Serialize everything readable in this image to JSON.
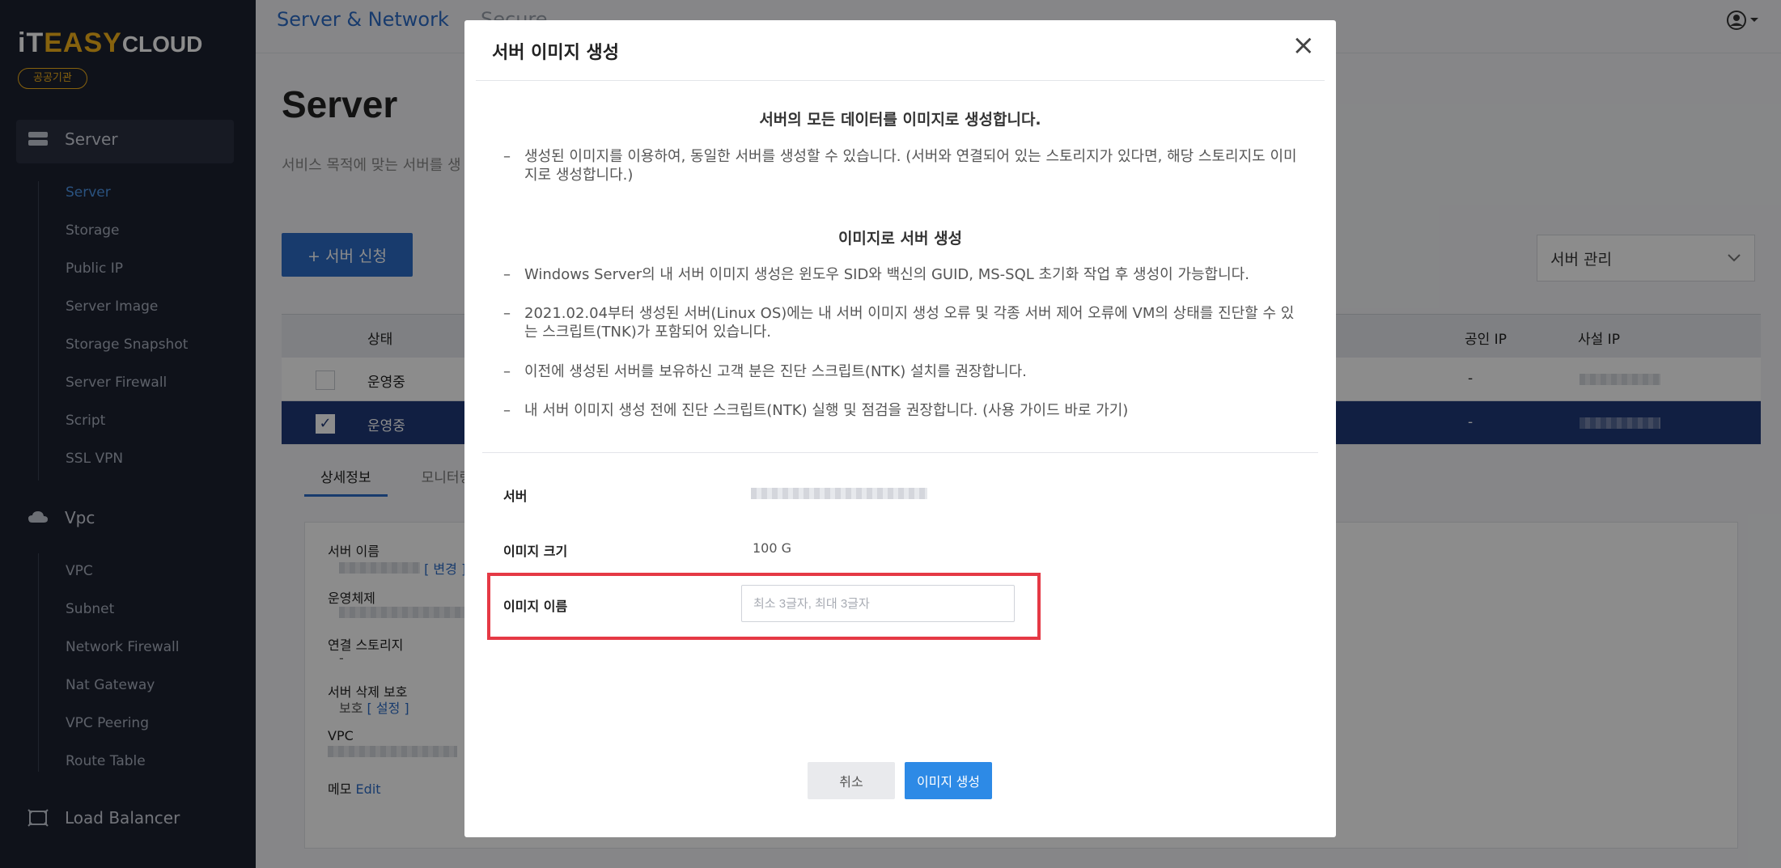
{
  "brand": {
    "logo_i": "iT",
    "logo_easy": "EASY",
    "logo_cloud": "CLOUD",
    "badge": "공공기관"
  },
  "sidebar": {
    "groups": [
      {
        "label": "Server",
        "icon": "server-icon"
      },
      {
        "label": "Vpc",
        "icon": "cloud-icon"
      },
      {
        "label": "Load Balancer",
        "icon": "load-balancer-icon"
      }
    ],
    "server_items": [
      "Server",
      "Storage",
      "Public IP",
      "Server Image",
      "Storage Snapshot",
      "Server Firewall",
      "Script",
      "SSL VPN"
    ],
    "vpc_items": [
      "VPC",
      "Subnet",
      "Network Firewall",
      "Nat Gateway",
      "VPC Peering",
      "Route Table"
    ]
  },
  "topbar": {
    "crumb_main": "Server & Network",
    "crumb_secure": "Secure"
  },
  "page": {
    "title": "Server",
    "description": "서비스 목적에 맞는 서버를 생",
    "new_button": "+ 서버 신청",
    "manage_select": "서버 관리",
    "table_headers": {
      "status": "상태",
      "public_ip": "공인 IP",
      "private_ip": "사설 IP"
    },
    "rows": [
      {
        "status": "운영중",
        "public_ip": "-"
      },
      {
        "status": "운영중",
        "public_ip": "-"
      }
    ],
    "tabs": [
      "상세정보",
      "모니터링"
    ],
    "detail": {
      "server_name_label": "서버 이름",
      "change_link": "[ 변경 ]",
      "os_label": "운영체제",
      "storage_label": "연결 스토리지",
      "storage_value": "-",
      "protect_label": "서버 삭제 보호",
      "protect_value": "보호",
      "protect_link": "[ 설정 ]",
      "vpc_label": "VPC",
      "memo_label": "메모",
      "memo_link": "Edit"
    }
  },
  "modal": {
    "title": "서버 이미지 생성",
    "section1_title": "서버의 모든 데이터를 이미지로 생성합니다.",
    "section1_bullets": [
      "생성된 이미지를 이용하여, 동일한 서버를 생성할 수 있습니다. (서버와 연결되어 있는 스토리지가 있다면, 해당 스토리지도 이미지로 생성합니다.)"
    ],
    "section2_title": "이미지로 서버 생성",
    "section2_bullets": [
      "Windows Server의 내 서버 이미지 생성은 윈도우 SID와 백신의 GUID, MS-SQL 초기화 작업 후 생성이 가능합니다.",
      "2021.02.04부터 생성된 서버(Linux OS)에는 내 서버 이미지 생성 오류 및 각종 서버 제어 오류에 VM의 상태를 진단할 수 있는 스크립트(TNK)가 포함되어 있습니다.",
      "이전에 생성된 서버를 보유하신 고객 분은 진단 스크립트(NTK) 설치를 권장합니다.",
      "내 서버 이미지 생성 전에 진단 스크립트(NTK) 실행 및 점검을 권장합니다. (사용 가이드 바로 가기)"
    ],
    "form": {
      "server_label": "서버",
      "size_label": "이미지 크기",
      "size_value": "100 G",
      "name_label": "이미지 이름",
      "name_value": "",
      "name_placeholder": "최소 3글자, 최대 3글자"
    },
    "cancel_button": "취소",
    "create_button": "이미지 생성"
  },
  "colors": {
    "sidebar_bg": "#1c2130",
    "accent_blue": "#2d6cc7",
    "logo_yellow": "#f5b21a",
    "selected_row": "#1f3a78",
    "highlight_red": "#e53945",
    "create_button": "#2d8ae6"
  }
}
